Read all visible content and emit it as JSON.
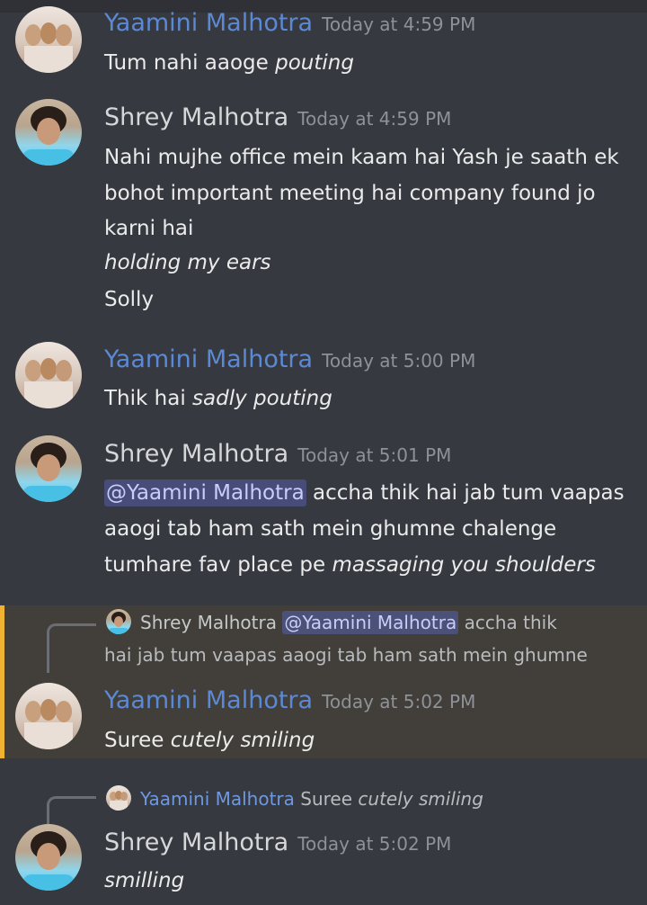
{
  "messages": [
    {
      "author": "Yaamini Malhotra",
      "time": "Today at 4:59 PM",
      "text": "Tum nahi aaoge",
      "action": "pouting"
    },
    {
      "author": "Shrey Malhotra",
      "time": "Today at 4:59 PM",
      "lines": [
        "Nahi mujhe office mein kaam hai Yash je saath ek",
        "bohot important meeting hai company found jo",
        "karni hai"
      ],
      "action_line": "holding my ears",
      "last_line": "Solly"
    },
    {
      "author": "Yaamini Malhotra",
      "time": "Today at 5:00 PM",
      "text": "Thik hai",
      "action": "sadly pouting"
    },
    {
      "author": "Shrey Malhotra",
      "time": "Today at 5:01 PM",
      "mention": "@Yaamini Malhotra",
      "line1_rest": "accha thik hai jab tum vaapas",
      "line2": "aaogi tab ham sath mein ghumne chalenge",
      "line3": "tumhare fav place pe",
      "action": "massaging you shoulders"
    },
    {
      "reply_author": "Shrey Malhotra",
      "reply_mention": "@Yaamini Malhotra",
      "reply_line1_rest": "accha thik",
      "reply_line2": "hai jab tum vaapas aaogi tab ham sath mein ghumne",
      "author": "Yaamini Malhotra",
      "time": "Today at 5:02 PM",
      "text": "Suree",
      "action": "cutely smiling",
      "highlight_color": "#f0b232"
    },
    {
      "reply_author": "Yaamini Malhotra",
      "reply_text": "Suree",
      "reply_action": "cutely smiling",
      "author": "Shrey Malhotra",
      "time": "Today at 5:02 PM",
      "action": "smilling"
    }
  ],
  "icons": {
    "yaamini_avatar": "avatar-photo",
    "shrey_avatar": "avatar-photo"
  },
  "colors": {
    "background": "#36393f",
    "yaamini_name": "#5b89d6",
    "mention_bg": "#474d78",
    "highlight": "#423f3a"
  }
}
